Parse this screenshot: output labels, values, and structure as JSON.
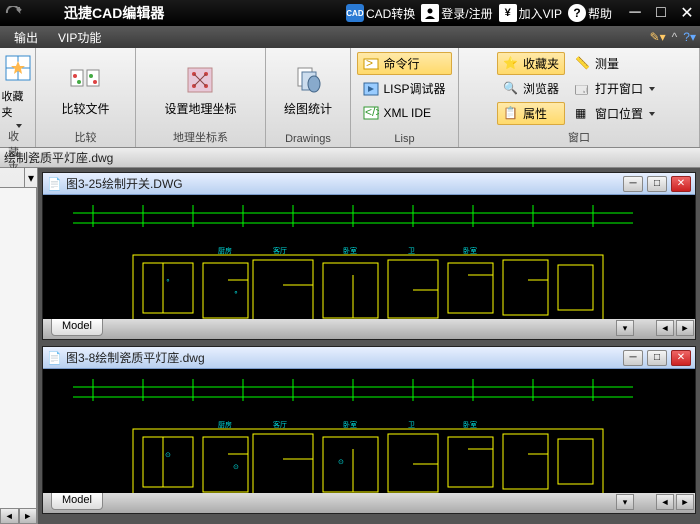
{
  "titlebar": {
    "app_title": "迅捷CAD编辑器",
    "cad_convert": "CAD转换",
    "login": "登录/注册",
    "vip": "加入VIP",
    "help": "帮助"
  },
  "tabs": {
    "output": "输出",
    "vip_func": "VIP功能"
  },
  "ribbon": {
    "fav_big": "收藏夹",
    "fav_group": "收藏夹",
    "compare_big": "比较文件",
    "compare_group": "比较",
    "geo_big": "设置地理坐标",
    "geo_group": "地理坐标系",
    "draw_big": "绘图统计",
    "draw_group": "Drawings",
    "lisp": {
      "cmd": "命令行",
      "debugger": "LISP调试器",
      "xml": "XML IDE",
      "group": "Lisp"
    },
    "win": {
      "fav": "收藏夹",
      "browser": "浏览器",
      "props": "属性",
      "measure": "测量",
      "openwin": "打开窗口",
      "winpos": "窗口位置",
      "group": "窗口"
    }
  },
  "pathbar": {
    "path": "绘制瓷质平灯座.dwg"
  },
  "docs": [
    {
      "title": "图3-25绘制开关.DWG",
      "model": "Model"
    },
    {
      "title": "图3-8绘制瓷质平灯座.dwg",
      "model": "Model"
    }
  ]
}
